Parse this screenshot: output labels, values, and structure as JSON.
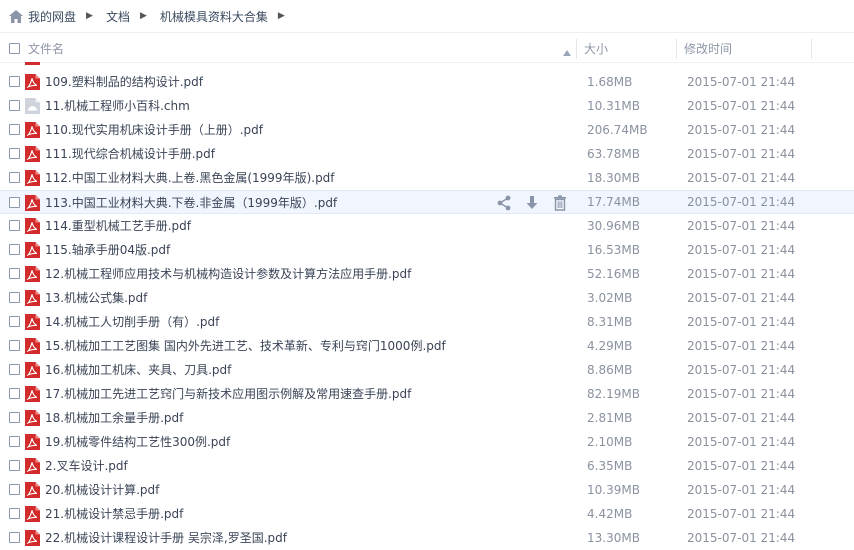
{
  "breadcrumb": [
    "我的网盘",
    "文档",
    "机械模具资料大合集"
  ],
  "columns": {
    "name": "文件名",
    "size": "大小",
    "modified": "修改时间"
  },
  "files": [
    {
      "name": "109.塑料制品的结构设计.pdf",
      "size": "1.68MB",
      "date": "2015-07-01 21:44",
      "icon": "pdf-icon"
    },
    {
      "name": "11.机械工程师小百科.chm",
      "size": "10.31MB",
      "date": "2015-07-01 21:44",
      "icon": "chm-icon"
    },
    {
      "name": "110.现代实用机床设计手册（上册）.pdf",
      "size": "206.74MB",
      "date": "2015-07-01 21:44",
      "icon": "pdf-icon"
    },
    {
      "name": "111.现代综合机械设计手册.pdf",
      "size": "63.78MB",
      "date": "2015-07-01 21:44",
      "icon": "pdf-icon"
    },
    {
      "name": "112.中国工业材料大典.上卷.黑色金属(1999年版).pdf",
      "size": "18.30MB",
      "date": "2015-07-01 21:44",
      "icon": "pdf-icon"
    },
    {
      "name": "113.中国工业材料大典.下卷.非金属（1999年版）.pdf",
      "size": "17.74MB",
      "date": "2015-07-01 21:44",
      "icon": "pdf-icon"
    },
    {
      "name": "114.重型机械工艺手册.pdf",
      "size": "30.96MB",
      "date": "2015-07-01 21:44",
      "icon": "pdf-icon"
    },
    {
      "name": "115.轴承手册04版.pdf",
      "size": "16.53MB",
      "date": "2015-07-01 21:44",
      "icon": "pdf-icon"
    },
    {
      "name": "12.机械工程师应用技术与机械构造设计参数及计算方法应用手册.pdf",
      "size": "52.16MB",
      "date": "2015-07-01 21:44",
      "icon": "pdf-icon"
    },
    {
      "name": "13.机械公式集.pdf",
      "size": "3.02MB",
      "date": "2015-07-01 21:44",
      "icon": "pdf-icon"
    },
    {
      "name": "14.机械工人切削手册（有）.pdf",
      "size": "8.31MB",
      "date": "2015-07-01 21:44",
      "icon": "pdf-icon"
    },
    {
      "name": "15.机械加工工艺图集 国内外先进工艺、技术革新、专利与窍门1000例.pdf",
      "size": "4.29MB",
      "date": "2015-07-01 21:44",
      "icon": "pdf-icon"
    },
    {
      "name": "16.机械加工机床、夹具、刀具.pdf",
      "size": "8.86MB",
      "date": "2015-07-01 21:44",
      "icon": "pdf-icon"
    },
    {
      "name": "17.机械加工先进工艺窍门与新技术应用图示例解及常用速查手册.pdf",
      "size": "82.19MB",
      "date": "2015-07-01 21:44",
      "icon": "pdf-icon"
    },
    {
      "name": "18.机械加工余量手册.pdf",
      "size": "2.81MB",
      "date": "2015-07-01 21:44",
      "icon": "pdf-icon"
    },
    {
      "name": "19.机械零件结构工艺性300例.pdf",
      "size": "2.10MB",
      "date": "2015-07-01 21:44",
      "icon": "pdf-icon"
    },
    {
      "name": "2.叉车设计.pdf",
      "size": "6.35MB",
      "date": "2015-07-01 21:44",
      "icon": "pdf-icon"
    },
    {
      "name": "20.机械设计计算.pdf",
      "size": "10.39MB",
      "date": "2015-07-01 21:44",
      "icon": "pdf-icon"
    },
    {
      "name": "21.机械设计禁忌手册.pdf",
      "size": "4.42MB",
      "date": "2015-07-01 21:44",
      "icon": "pdf-icon"
    },
    {
      "name": "22.机械设计课程设计手册 吴宗泽,罗圣国.pdf",
      "size": "13.30MB",
      "date": "2015-07-01 21:44",
      "icon": "pdf-icon"
    }
  ],
  "hover_row_actions": [
    "share-icon",
    "download-icon",
    "delete-icon"
  ],
  "colors": {
    "pdf": "#d12b2b",
    "hover_row": "#f1f6fe",
    "icon_gray": "#8a96a8"
  }
}
